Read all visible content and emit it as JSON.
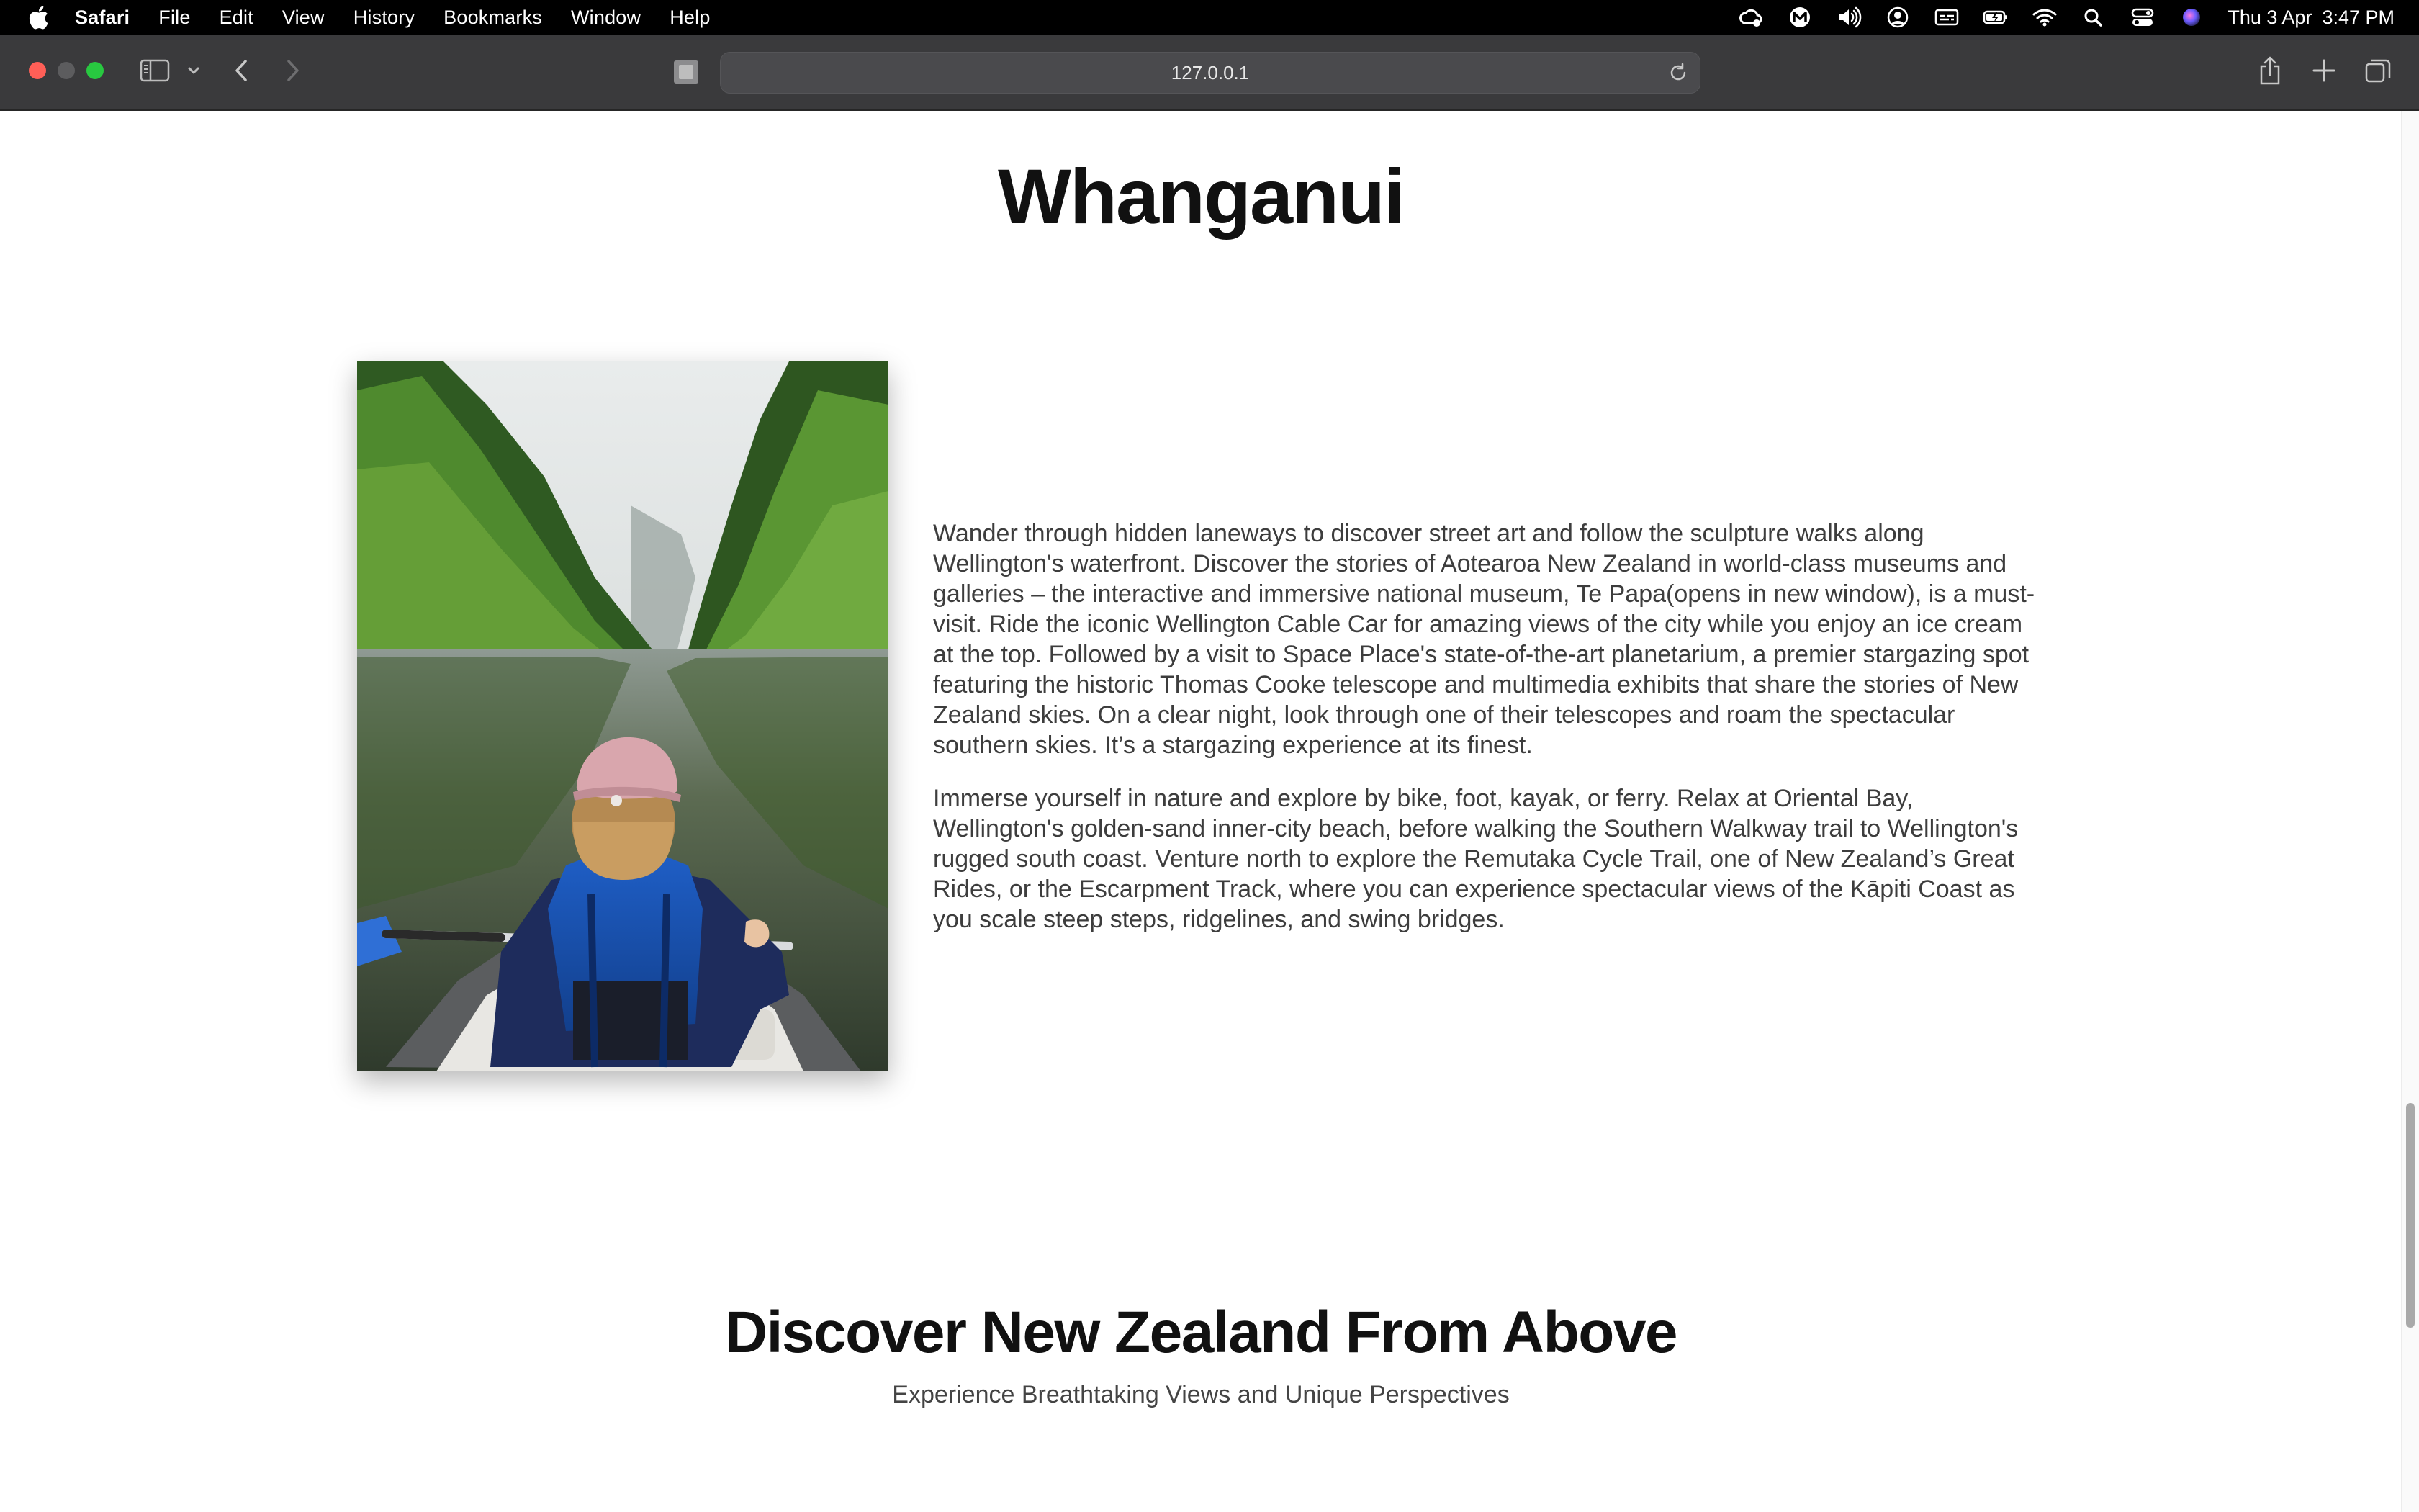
{
  "menubar": {
    "app_name": "Safari",
    "items": [
      "File",
      "Edit",
      "View",
      "History",
      "Bookmarks",
      "Window",
      "Help"
    ],
    "status_icons": [
      "creative-cloud-icon",
      "malwarebytes-icon",
      "volume-icon",
      "user-icon",
      "caption-icon",
      "battery-icon",
      "wifi-icon",
      "spotlight-icon",
      "control-center-icon",
      "siri-icon"
    ],
    "date": "Thu 3 Apr",
    "time": "3:47 PM"
  },
  "browser": {
    "url": "127.0.0.1"
  },
  "page": {
    "title": "Whanganui",
    "image_alt": "Person kayaking on a river between forested cliffs",
    "paragraphs": [
      "Wander through hidden laneways to discover street art and follow the sculpture walks along Wellington's waterfront. Discover the stories of Aotearoa New Zealand in world-class museums and galleries – the interactive and immersive national museum, Te Papa(opens in new window), is a must-visit. Ride the iconic Wellington Cable Car for amazing views of the city while you enjoy an ice cream at the top. Followed by a visit to Space Place's state-of-the-art planetarium, a premier stargazing spot featuring the historic Thomas Cooke telescope and multimedia exhibits that share the stories of New Zealand skies. On a clear night, look through one of their telescopes and roam the spectacular southern skies. It’s a stargazing experience at its finest.",
      "Immerse yourself in nature and explore by bike, foot, kayak, or ferry. Relax at Oriental Bay, Wellington's golden-sand inner-city beach, before walking the Southern Walkway trail to Wellington's rugged south coast. Venture north to explore the Remutaka Cycle Trail, one of New Zealand’s Great Rides, or the Escarpment Track, where you can experience spectacular views of the Kāpiti Coast as you scale steep steps, ridgelines, and swing bridges."
    ],
    "discover_title": "Discover New Zealand From Above",
    "discover_subtitle": "Experience Breathtaking Views and Unique Perspectives"
  },
  "colors": {
    "menubar_bg": "#000000",
    "toolbar_bg": "#3a3a3c",
    "page_bg": "#ffffff",
    "heading": "#111111",
    "body_text": "#3d3d3d"
  }
}
